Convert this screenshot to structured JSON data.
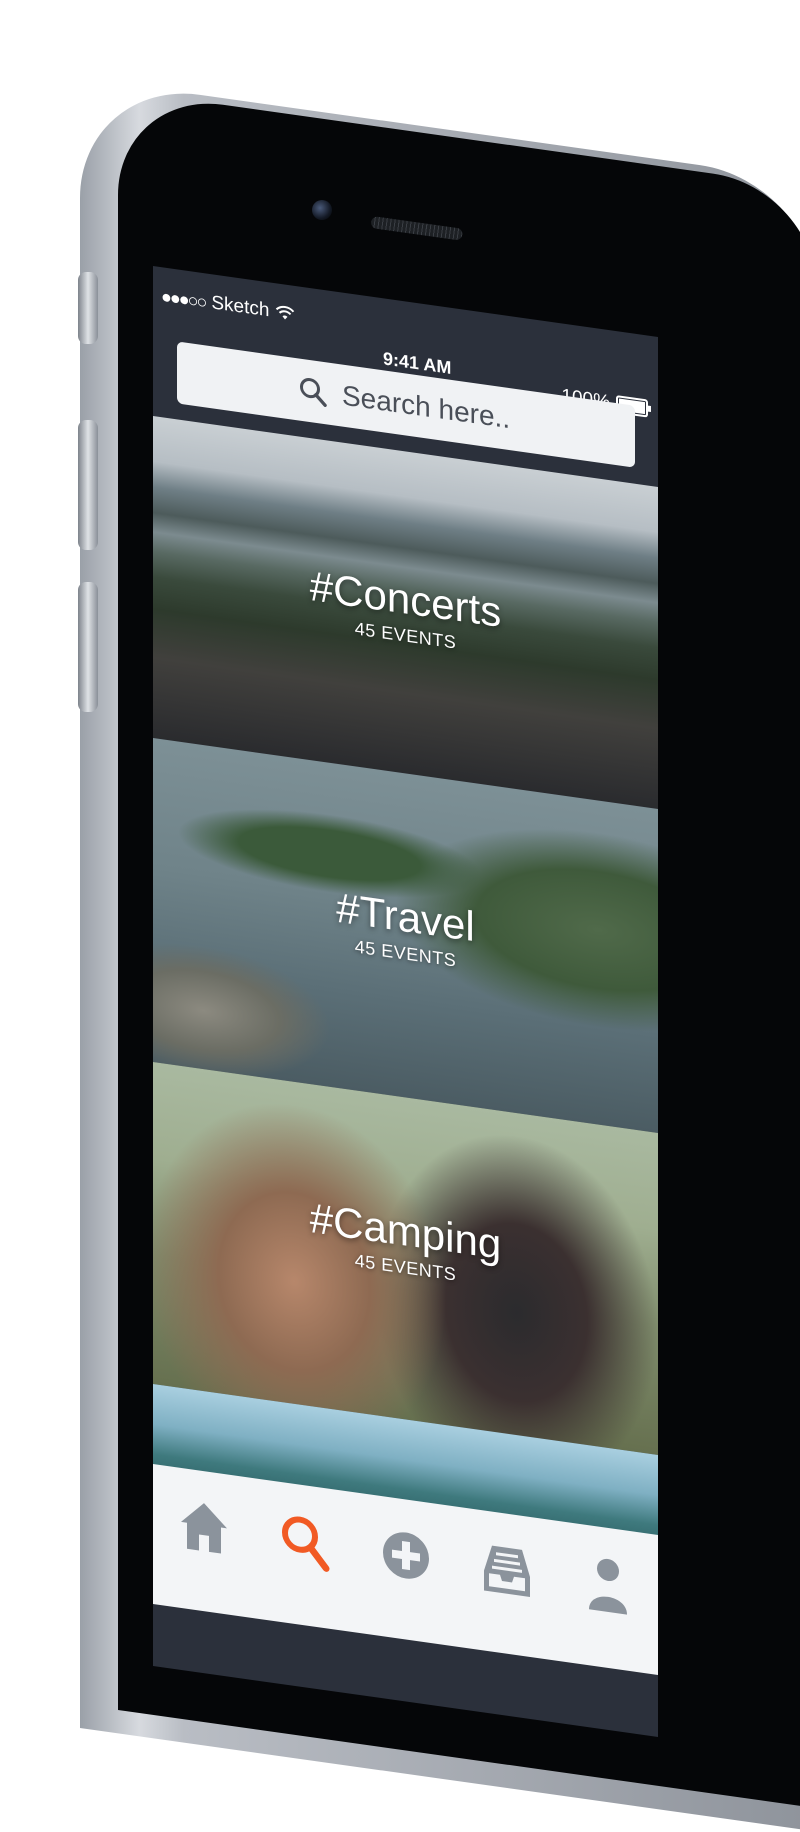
{
  "status_bar": {
    "carrier": "Sketch",
    "signal": "●●●○○",
    "time": "9:41 AM",
    "battery": "100%"
  },
  "search": {
    "placeholder": "Search here..."
  },
  "categories": [
    {
      "title": "#Concerts",
      "count": "45 EVENTS"
    },
    {
      "title": "#Travel",
      "count": "45 EVENTS"
    },
    {
      "title": "#Camping",
      "count": "45 EVENTS"
    }
  ],
  "tab_bar": {
    "items": [
      {
        "icon": "home-icon",
        "color": "#8b939c"
      },
      {
        "icon": "search-icon",
        "color": "#f15a24",
        "active": true
      },
      {
        "icon": "add-icon",
        "color": "#8b939c"
      },
      {
        "icon": "inbox-icon",
        "color": "#8b939c"
      },
      {
        "icon": "profile-icon",
        "color": "#8b939c"
      }
    ]
  },
  "colors": {
    "accent": "#f15a24",
    "header_bg": "#2b303b",
    "search_bg": "#f0f2f4",
    "tab_icon": "#8b939c"
  }
}
